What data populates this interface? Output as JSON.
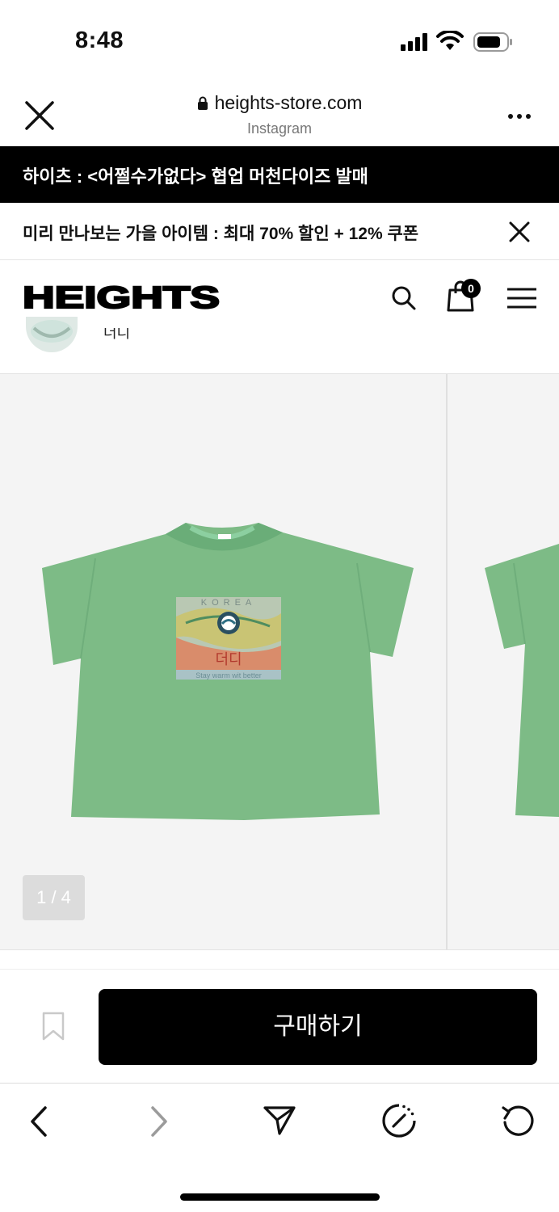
{
  "status_bar": {
    "time": "8:48"
  },
  "browser": {
    "url": "heights-store.com",
    "subtitle": "Instagram"
  },
  "banners": {
    "primary": "하이츠 : <어쩔수가없다> 협업 머천다이즈 발매",
    "secondary": "미리 만나보는 가을 아이템 : 최대 70% 할인 + 12% 쿠폰"
  },
  "site_header": {
    "logo": "HEIGHTS",
    "cart_count": "0"
  },
  "product_strip": {
    "name": "더디"
  },
  "gallery": {
    "counter": "1 / 4",
    "print_brand": "KOREA",
    "print_hangul": "더디",
    "print_caption": "Stay warm wit better"
  },
  "buy_bar": {
    "buy_label": "구매하기"
  },
  "colors": {
    "shirt_green": "#7dbb86",
    "banner_black": "#000000",
    "gallery_bg": "#f4f4f4"
  }
}
